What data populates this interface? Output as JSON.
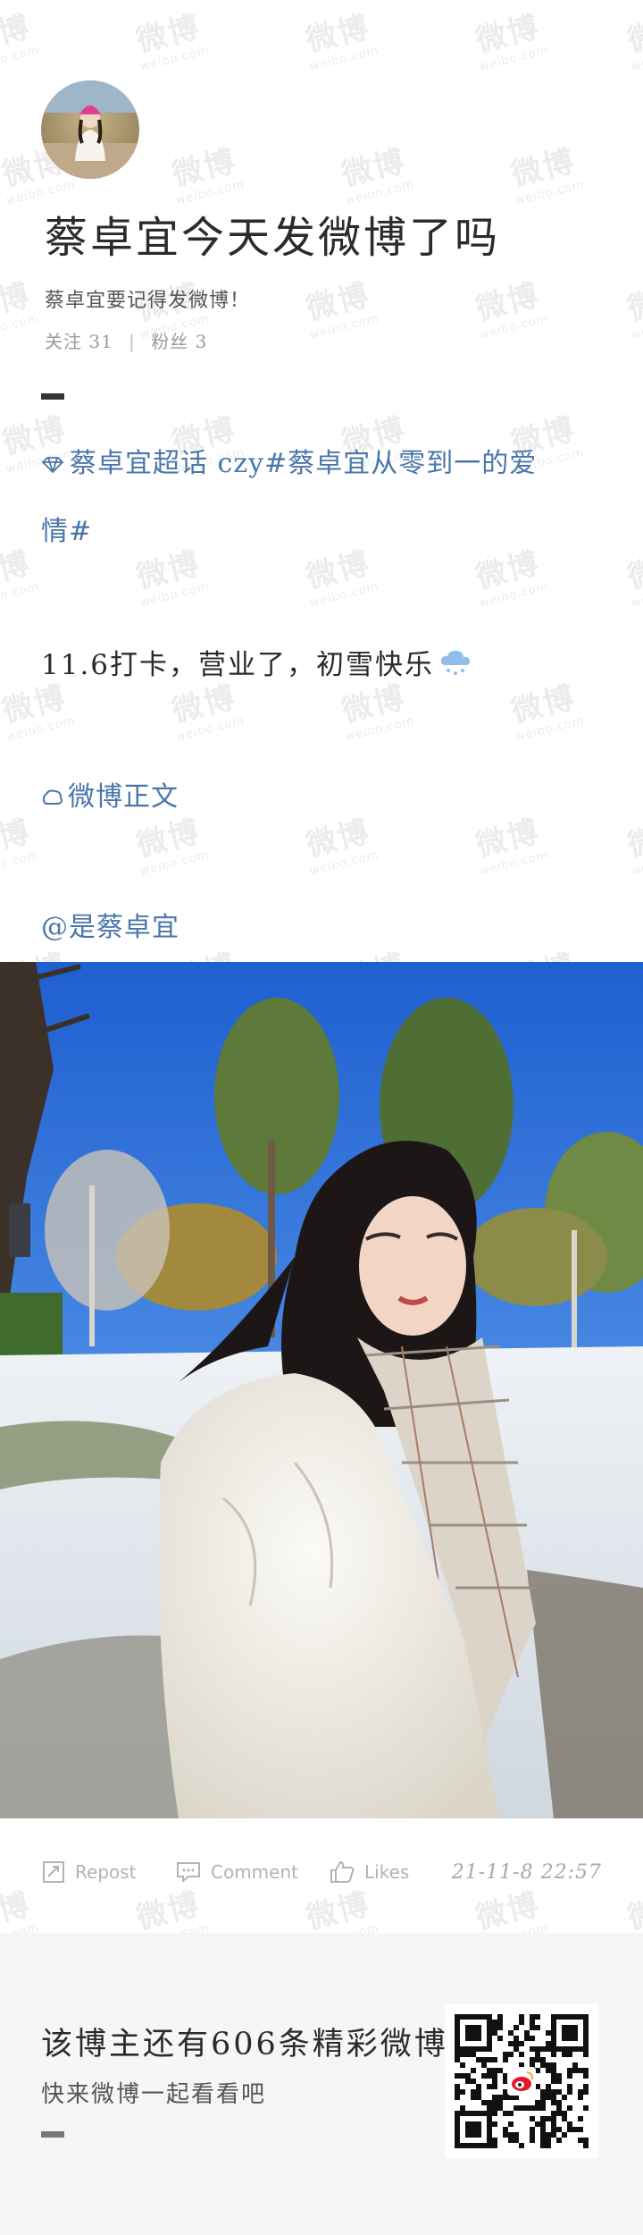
{
  "watermark": {
    "text": "微博",
    "subtext": "weibo.com"
  },
  "profile": {
    "title": "蔡卓宜今天发微博了吗",
    "bio": "蔡卓宜要记得发微博！",
    "following_label": "关注",
    "following_count": "31",
    "followers_label": "粉丝",
    "followers_count": "3"
  },
  "post": {
    "supertopic_line1": "蔡卓宜超话 czy#蔡卓宜从零到一的爱",
    "supertopic_line2": "情#",
    "body": "11.6打卡，营业了，初雪快乐",
    "full_text_link": "微博正文",
    "mention": "@是蔡卓宜"
  },
  "actions": {
    "repost": "Repost",
    "comment": "Comment",
    "likes": "Likes",
    "timestamp": "21-11-8 22:57"
  },
  "footer": {
    "title": "该博主还有606条精彩微博",
    "subtitle": "快来微博一起看看吧"
  },
  "colors": {
    "link": "#4a76a8",
    "text": "#2b2b2b",
    "muted": "#9a9a9a",
    "footer_bg": "#f6f6f6"
  },
  "icons": [
    "diamond-icon",
    "snow-cloud-icon",
    "full-text-icon",
    "repost-icon",
    "comment-icon",
    "like-icon",
    "weibo-logo-icon",
    "qr-code"
  ]
}
